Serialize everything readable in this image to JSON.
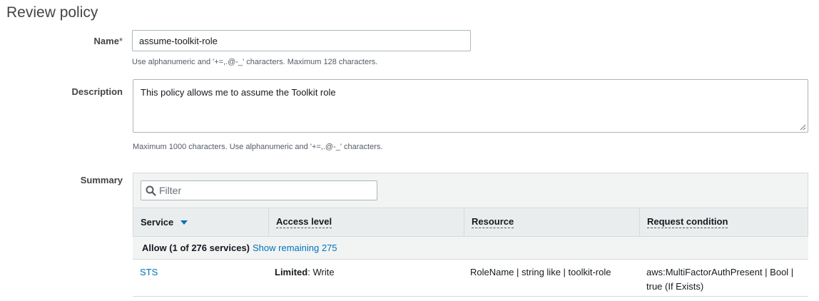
{
  "page": {
    "title": "Review policy"
  },
  "name_field": {
    "label": "Name",
    "required_marker": "*",
    "value": "assume-toolkit-role",
    "hint": "Use alphanumeric and '+=,.@-_' characters. Maximum 128 characters."
  },
  "description_field": {
    "label": "Description",
    "value": "This policy allows me to assume the Toolkit role",
    "hint": "Maximum 1000 characters. Use alphanumeric and '+=,.@-_' characters."
  },
  "summary": {
    "label": "Summary",
    "filter": {
      "placeholder": "Filter",
      "icon": "search-icon"
    },
    "columns": [
      {
        "label": "Service",
        "sort": "descending"
      },
      {
        "label": "Access level"
      },
      {
        "label": "Resource"
      },
      {
        "label": "Request condition"
      }
    ],
    "group": {
      "label": "Allow (1 of 276 services)",
      "show_remaining_link": "Show remaining 275"
    },
    "rows": [
      {
        "service": "STS",
        "access_level_strong": "Limited",
        "access_level_rest": ": Write",
        "resource": "RoleName | string like | toolkit-role",
        "condition_line1": "aws:MultiFactorAuthPresent | Bool |",
        "condition_line2": "true (If Exists)"
      }
    ]
  },
  "colors": {
    "link": "#0073bb",
    "header_bg": "#eaeded",
    "panel_bg": "#f2f3f3",
    "border": "#d5dbdb"
  }
}
